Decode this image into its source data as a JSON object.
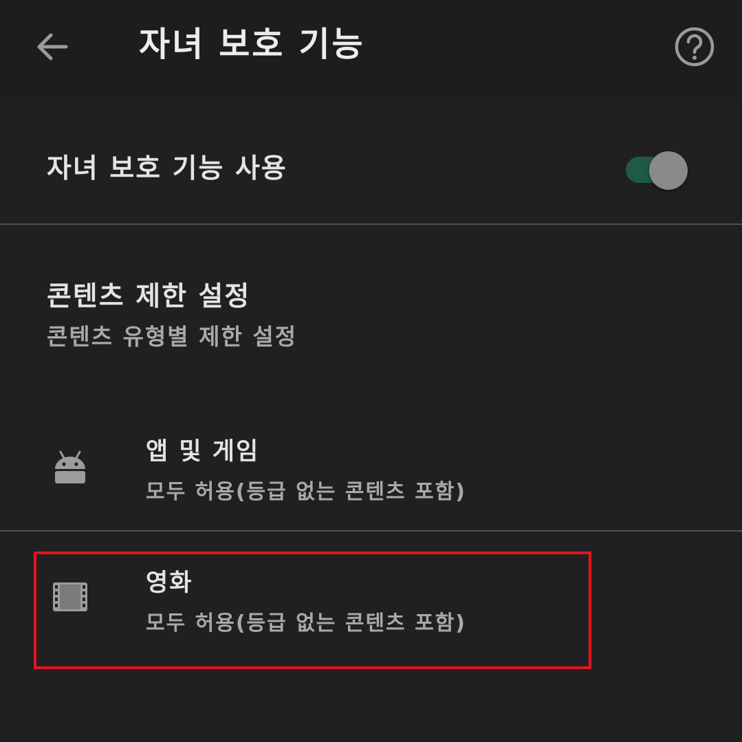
{
  "header": {
    "title": "자녀 보호 기능",
    "back_icon": "arrow-left-icon",
    "help_icon": "help-circle-icon"
  },
  "parental_controls": {
    "label": "자녀 보호 기능 사용",
    "enabled": true,
    "track_color": "#1f5a43",
    "thumb_color": "#8a8a8c"
  },
  "content_restrictions": {
    "title": "콘텐츠 제한 설정",
    "subtitle": "콘텐츠 유형별 제한 설정"
  },
  "items": [
    {
      "icon": "android-icon",
      "title": "앱 및 게임",
      "subtitle": "모두 허용(등급 없는 콘텐츠 포함)"
    },
    {
      "icon": "film-icon",
      "title": "영화",
      "subtitle": "모두 허용(등급 없는 콘텐츠 포함)"
    }
  ],
  "highlight_color": "#e3141d"
}
